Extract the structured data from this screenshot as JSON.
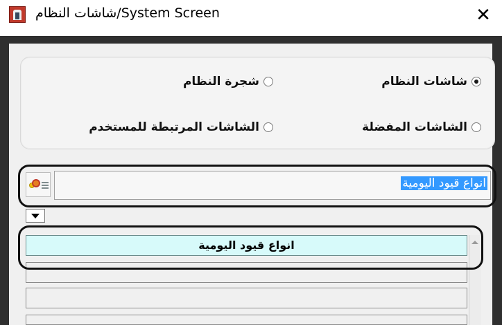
{
  "window": {
    "title": "شاشات النظام/System Screen",
    "close_label": "✕"
  },
  "radio_options": [
    {
      "label": "شاشات النظام",
      "checked": true
    },
    {
      "label": "شجرة النظام",
      "checked": false
    },
    {
      "label": "الشاشات المفضلة",
      "checked": false
    },
    {
      "label": "الشاشات المرتبطة للمستخدم",
      "checked": false
    }
  ],
  "search": {
    "value": "انواع قيود اليومية"
  },
  "results": {
    "rows": [
      "انواع قيود اليومية",
      "",
      "",
      ""
    ],
    "selected_index": 0
  },
  "colors": {
    "selection_highlight": "#3399ff",
    "selected_row": "#d7fafa",
    "frame_dark": "#2f2f2f"
  }
}
